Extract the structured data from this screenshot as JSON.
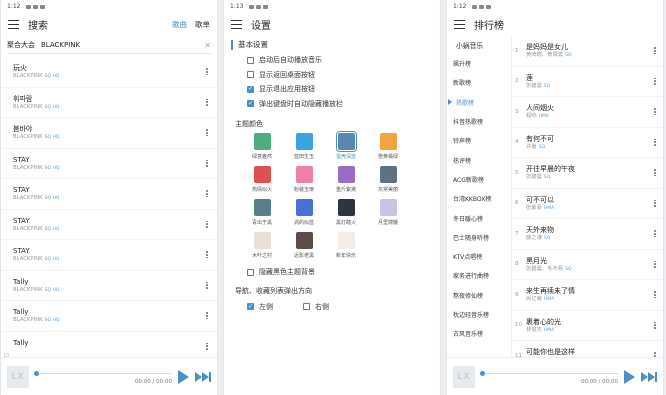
{
  "screen1": {
    "status": {
      "time": "1:12"
    },
    "title": "搜索",
    "tabs": [
      "歌曲",
      "歌单"
    ],
    "search": {
      "source": "聚合大会",
      "query": "BLACKPINK"
    },
    "songs": [
      {
        "title": "玩火",
        "artist": "BLACKPINK",
        "tags": "SQ HQ"
      },
      {
        "title": "휘파람",
        "artist": "BLACKPINK",
        "tags": "SQ HQ"
      },
      {
        "title": "붐바야",
        "artist": "BLACKPINK",
        "tags": "SQ HQ"
      },
      {
        "title": "STAY",
        "artist": "BLACKPINK",
        "tags": "SQ HQ"
      },
      {
        "title": "STAY",
        "artist": "BLACKPINK",
        "tags": "SQ HQ"
      },
      {
        "title": "STAY",
        "artist": "BLACKPINK",
        "tags": "SQ HQ"
      },
      {
        "title": "STAY",
        "artist": "BLACKPINK",
        "tags": "SQ HQ"
      },
      {
        "title": "Tally",
        "artist": "BLACKPINK",
        "tags": "SQ HQ"
      },
      {
        "title": "Tally",
        "artist": "BLACKPINK",
        "tags": "SQ HQ"
      },
      {
        "title": "Tally",
        "artist": "",
        "tags": "",
        "num": "10"
      }
    ],
    "player": {
      "cover": "LX",
      "time": "00:00 / 00:00"
    }
  },
  "screen2": {
    "status": {
      "time": "1:13"
    },
    "title": "设置",
    "section": "基本设置",
    "options": [
      {
        "label": "启动后自动播放音乐",
        "checked": false
      },
      {
        "label": "显示返回桌面按钮",
        "checked": false
      },
      {
        "label": "显示退出应用按钮",
        "checked": true
      },
      {
        "label": "弹出键盘时自动隐藏播放栏",
        "checked": true
      }
    ],
    "theme_label": "主题颜色",
    "themes": [
      {
        "name": "绿意盎然",
        "color": "#4caf7d"
      },
      {
        "name": "蓝田生玉",
        "color": "#3ba3e0"
      },
      {
        "name": "蛋壳深蓝",
        "color": "#5b86b0",
        "selected": true
      },
      {
        "name": "橙黄橘绿",
        "color": "#f3a43a"
      },
      {
        "name": "热情似火",
        "color": "#e05050"
      },
      {
        "name": "粉装玉琢",
        "color": "#f07fa6"
      },
      {
        "name": "重斤紫黛",
        "color": "#9b6bc8"
      },
      {
        "name": "灰常美丽",
        "color": "#5f7284"
      },
      {
        "name": "青出于黑",
        "color": "#5a7d8a"
      },
      {
        "name": "涡的似蓝",
        "color": "#4a6fd8"
      },
      {
        "name": "黑灯瞎火",
        "color": "#2e3540"
      },
      {
        "name": "月里嫦娥",
        "color": "#c8c6e8"
      },
      {
        "name": "木叶之村",
        "color": "#e8e0d4"
      },
      {
        "name": "近影老黑",
        "color": "#5a4d4a"
      },
      {
        "name": "新年快乐",
        "color": "#f2ede6"
      }
    ],
    "dark_option": {
      "label": "隐藏黑色主题背景",
      "checked": false
    },
    "nav_label": "导航、收藏列表弹出方向",
    "directions": [
      {
        "label": "左侧",
        "checked": true
      },
      {
        "label": "右侧",
        "checked": false
      }
    ]
  },
  "screen3": {
    "status": {
      "time": "1:12"
    },
    "title": "排行榜",
    "source": "小蜗音乐",
    "boards": [
      "飙升榜",
      "新歌榜",
      "热歌榜",
      "抖音热歌榜",
      "铃声榜",
      "热评榜",
      "ACG新歌榜",
      "台湾KKBOX榜",
      "冬日暖心榜",
      "巴士随身听榜",
      "KTV点唱榜",
      "家务进行曲榜",
      "熬夜修仙榜",
      "枕边轻音乐榜",
      "古风音乐榜"
    ],
    "active_board": "热歌榜",
    "songs": [
      {
        "n": "1",
        "title": "是妈妈是女儿",
        "artist": "黄绮珊、黄霄雲",
        "tag": "SQ"
      },
      {
        "n": "2",
        "title": "莲",
        "artist": "张碧晨",
        "tag": "SQ"
      },
      {
        "n": "3",
        "title": "人间烟火",
        "artist": "程响",
        "tag": "HMA"
      },
      {
        "n": "4",
        "title": "有何不可",
        "artist": "许嵩",
        "tag": "SQ"
      },
      {
        "n": "5",
        "title": "开往早晨的午夜",
        "artist": "张碧晨",
        "tag": "SQ"
      },
      {
        "n": "6",
        "title": "可不可以",
        "artist": "张紫豪",
        "tag": "HMA"
      },
      {
        "n": "7",
        "title": "天外来物",
        "artist": "薛之谦",
        "tag": "SQ"
      },
      {
        "n": "8",
        "title": "黑月光",
        "artist": "张碧晨、毛不易",
        "tag": "SQ"
      },
      {
        "n": "9",
        "title": "来生再续未了情",
        "artist": "尚亿菊",
        "tag": "HMA"
      },
      {
        "n": "10",
        "title": "裹着心的光",
        "artist": "林俊杰",
        "tag": "HMA"
      },
      {
        "n": "11",
        "title": "可能你也是这样",
        "artist": "",
        "tag": ""
      }
    ],
    "player": {
      "cover": "LX",
      "time": "00:00 / 00:00"
    }
  }
}
